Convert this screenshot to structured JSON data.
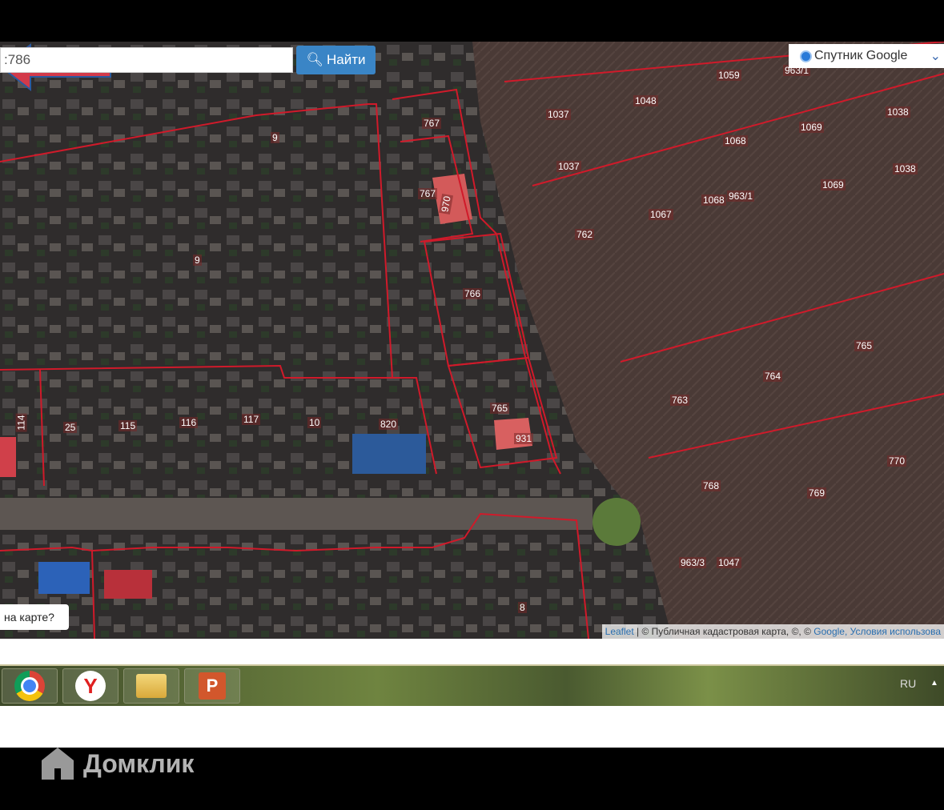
{
  "search": {
    "value": ":786",
    "button": "Найти"
  },
  "layer_select": {
    "selected": "Спутник Google"
  },
  "map_prompt": "на карте?",
  "attribution": {
    "leaflet": "Leaflet",
    "sep": " | © Публичная кадастровая карта, ©, © ",
    "google": "Google",
    "terms": ", Условия использова"
  },
  "parcels": [
    "9",
    "9",
    "767",
    "767",
    "970",
    "766",
    "765",
    "931",
    "820",
    "10",
    "117",
    "116",
    "115",
    "25",
    "114",
    "8",
    "1059",
    "963/1",
    "1048",
    "1037",
    "1038",
    "1069",
    "1068",
    "1037",
    "1038",
    "1069",
    "1068",
    "963/1",
    "1067",
    "762",
    "765",
    "764",
    "763",
    "770",
    "768",
    "769",
    "963/3",
    "1047"
  ],
  "taskbar": {
    "language": "RU",
    "apps": [
      "chrome",
      "yandex-browser",
      "file-explorer",
      "powerpoint"
    ]
  },
  "watermark": "Домклик",
  "colors": {
    "parcel_border": "#d01a2a",
    "button": "#3a85c6",
    "arrow": "#d33a4a"
  }
}
